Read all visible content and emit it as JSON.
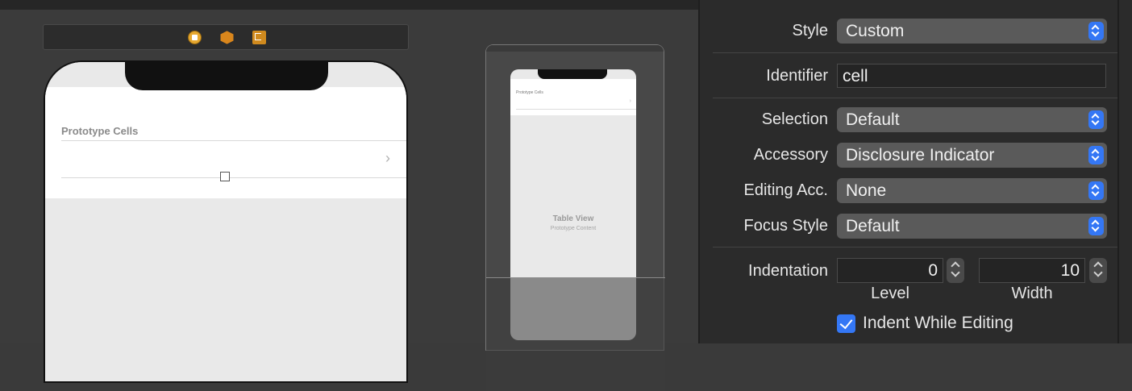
{
  "canvas": {
    "scene_dock_icons": [
      "view-controller-icon",
      "first-responder-icon",
      "exit-icon"
    ],
    "table": {
      "section_header": "Prototype Cells",
      "cell_accessory": "›"
    },
    "minimap": {
      "cell_label": "Prototype Cells",
      "title": "Table View",
      "subtitle": "Prototype Content"
    }
  },
  "inspector": {
    "style": {
      "label": "Style",
      "value": "Custom"
    },
    "identifier": {
      "label": "Identifier",
      "value": "cell"
    },
    "selection": {
      "label": "Selection",
      "value": "Default"
    },
    "accessory": {
      "label": "Accessory",
      "value": "Disclosure Indicator"
    },
    "editing_acc": {
      "label": "Editing Acc.",
      "value": "None"
    },
    "focus_style": {
      "label": "Focus Style",
      "value": "Default"
    },
    "indentation": {
      "label": "Indentation",
      "level_value": "0",
      "level_label": "Level",
      "width_value": "10",
      "width_label": "Width"
    },
    "indent_while_editing": {
      "label": "Indent While Editing",
      "checked": true
    }
  },
  "colors": {
    "accent": "#3477f5",
    "canvas_bg": "#3b3b3b",
    "inspector_bg": "#2b2b2b"
  }
}
